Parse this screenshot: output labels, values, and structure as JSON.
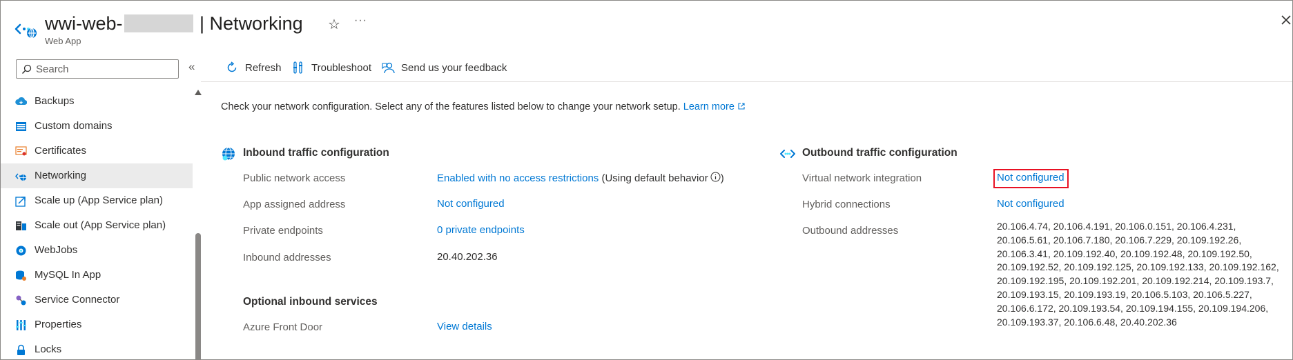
{
  "header": {
    "title_prefix": "wwi-web-",
    "title_suffix": "| Networking",
    "subtitle": "Web App"
  },
  "sidebar": {
    "search_placeholder": "Search",
    "items": [
      {
        "label": "Backups",
        "icon": "backups-icon"
      },
      {
        "label": "Custom domains",
        "icon": "custom-domains-icon"
      },
      {
        "label": "Certificates",
        "icon": "certificates-icon"
      },
      {
        "label": "Networking",
        "icon": "networking-icon",
        "active": true
      },
      {
        "label": "Scale up (App Service plan)",
        "icon": "scale-up-icon"
      },
      {
        "label": "Scale out (App Service plan)",
        "icon": "scale-out-icon"
      },
      {
        "label": "WebJobs",
        "icon": "webjobs-icon"
      },
      {
        "label": "MySQL In App",
        "icon": "mysql-icon"
      },
      {
        "label": "Service Connector",
        "icon": "service-connector-icon"
      },
      {
        "label": "Properties",
        "icon": "properties-icon"
      },
      {
        "label": "Locks",
        "icon": "locks-icon"
      }
    ]
  },
  "toolbar": {
    "refresh": "Refresh",
    "troubleshoot": "Troubleshoot",
    "feedback": "Send us your feedback"
  },
  "intro": {
    "text": "Check your network configuration. Select any of the features listed below to change your network setup.",
    "learn_more": "Learn more"
  },
  "inbound": {
    "title": "Inbound traffic configuration",
    "public_access_label": "Public network access",
    "public_access_value": "Enabled with no access restrictions",
    "public_access_note": "(Using default behavior",
    "assigned_address_label": "App assigned address",
    "assigned_address_value": "Not configured",
    "private_endpoints_label": "Private endpoints",
    "private_endpoints_value": "0 private endpoints",
    "inbound_addresses_label": "Inbound addresses",
    "inbound_addresses_value": "20.40.202.36"
  },
  "optional_inbound": {
    "title": "Optional inbound services",
    "front_door_label": "Azure Front Door",
    "front_door_value": "View details"
  },
  "outbound": {
    "title": "Outbound traffic configuration",
    "vnet_label": "Virtual network integration",
    "vnet_value": "Not configured",
    "hybrid_label": "Hybrid connections",
    "hybrid_value": "Not configured",
    "outbound_addresses_label": "Outbound addresses",
    "outbound_addresses_value": "20.106.4.74, 20.106.4.191, 20.106.0.151, 20.106.4.231, 20.106.5.61, 20.106.7.180, 20.106.7.229, 20.109.192.26, 20.106.3.41, 20.109.192.40, 20.109.192.48, 20.109.192.50, 20.109.192.52, 20.109.192.125, 20.109.192.133, 20.109.192.162, 20.109.192.195, 20.109.192.201, 20.109.192.214, 20.109.193.7, 20.109.193.15, 20.109.193.19, 20.106.5.103, 20.106.5.227, 20.106.6.172, 20.109.193.54, 20.109.194.155, 20.109.194.206, 20.109.193.37, 20.106.6.48, 20.40.202.36"
  },
  "colors": {
    "link": "#0078d4",
    "highlight_border": "#e81123",
    "active_nav": "#ebebeb"
  }
}
